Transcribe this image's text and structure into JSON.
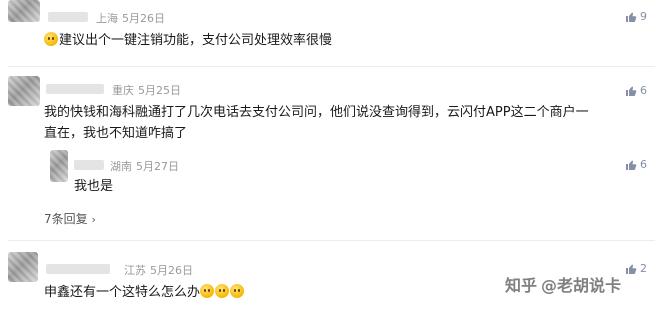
{
  "comments": [
    {
      "location": "上海",
      "date": "5月26日",
      "likes": "9",
      "text": "建议出个一键注销功能，支付公司处理效率很慢"
    },
    {
      "location": "重庆",
      "date": "5月25日",
      "likes": "6",
      "text_line1": "我的快钱和海科融通打了几次电话去支付公司问，他们说没查询得到，云闪付APP这二个商户一",
      "text_line2": "直在，我也不知道咋搞了"
    },
    {
      "location": "湖南",
      "date": "5月27日",
      "likes": "6",
      "text": "我也是"
    },
    {
      "location": "江苏",
      "date": "5月26日",
      "likes": "2",
      "text": "申鑫还有一个这特么怎么办"
    }
  ],
  "replies_link": "7条回复",
  "watermark": {
    "platform": "知乎",
    "author": "@老胡说卡"
  },
  "icons": {
    "like": "thumb-up-icon",
    "emoji": "face-emoji-icon"
  }
}
